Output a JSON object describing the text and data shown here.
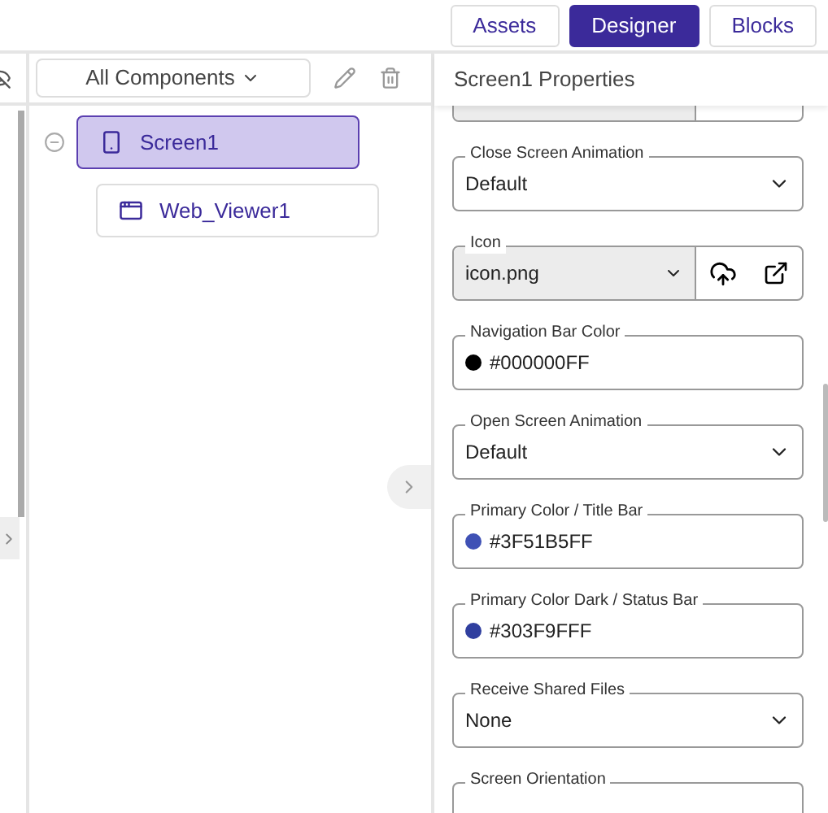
{
  "top_tabs": [
    {
      "label": "Assets",
      "selected": false
    },
    {
      "label": "Designer",
      "selected": true
    },
    {
      "label": "Blocks",
      "selected": false
    }
  ],
  "components_panel": {
    "filter": "All Components",
    "tree": [
      {
        "label": "Screen1",
        "selected": true,
        "expanded": true,
        "children": [
          {
            "label": "Web_Viewer1",
            "selected": false
          }
        ]
      }
    ]
  },
  "properties_panel": {
    "title": "Screen1 Properties",
    "fields": [
      {
        "kind": "asset_partial"
      },
      {
        "kind": "select",
        "label": "Close Screen Animation",
        "value": "Default"
      },
      {
        "kind": "asset",
        "label": "Icon",
        "value": "icon.png"
      },
      {
        "kind": "color",
        "label": "Navigation Bar Color",
        "value": "#000000FF",
        "color": "#000000"
      },
      {
        "kind": "select",
        "label": "Open Screen Animation",
        "value": "Default"
      },
      {
        "kind": "color",
        "label": "Primary Color / Title Bar",
        "value": "#3F51B5FF",
        "color": "#3f51b5"
      },
      {
        "kind": "color",
        "label": "Primary Color Dark / Status Bar",
        "value": "#303F9FFF",
        "color": "#303f9f"
      },
      {
        "kind": "select",
        "label": "Receive Shared Files",
        "value": "None"
      },
      {
        "kind": "select_partial",
        "label": "Screen Orientation"
      }
    ]
  }
}
